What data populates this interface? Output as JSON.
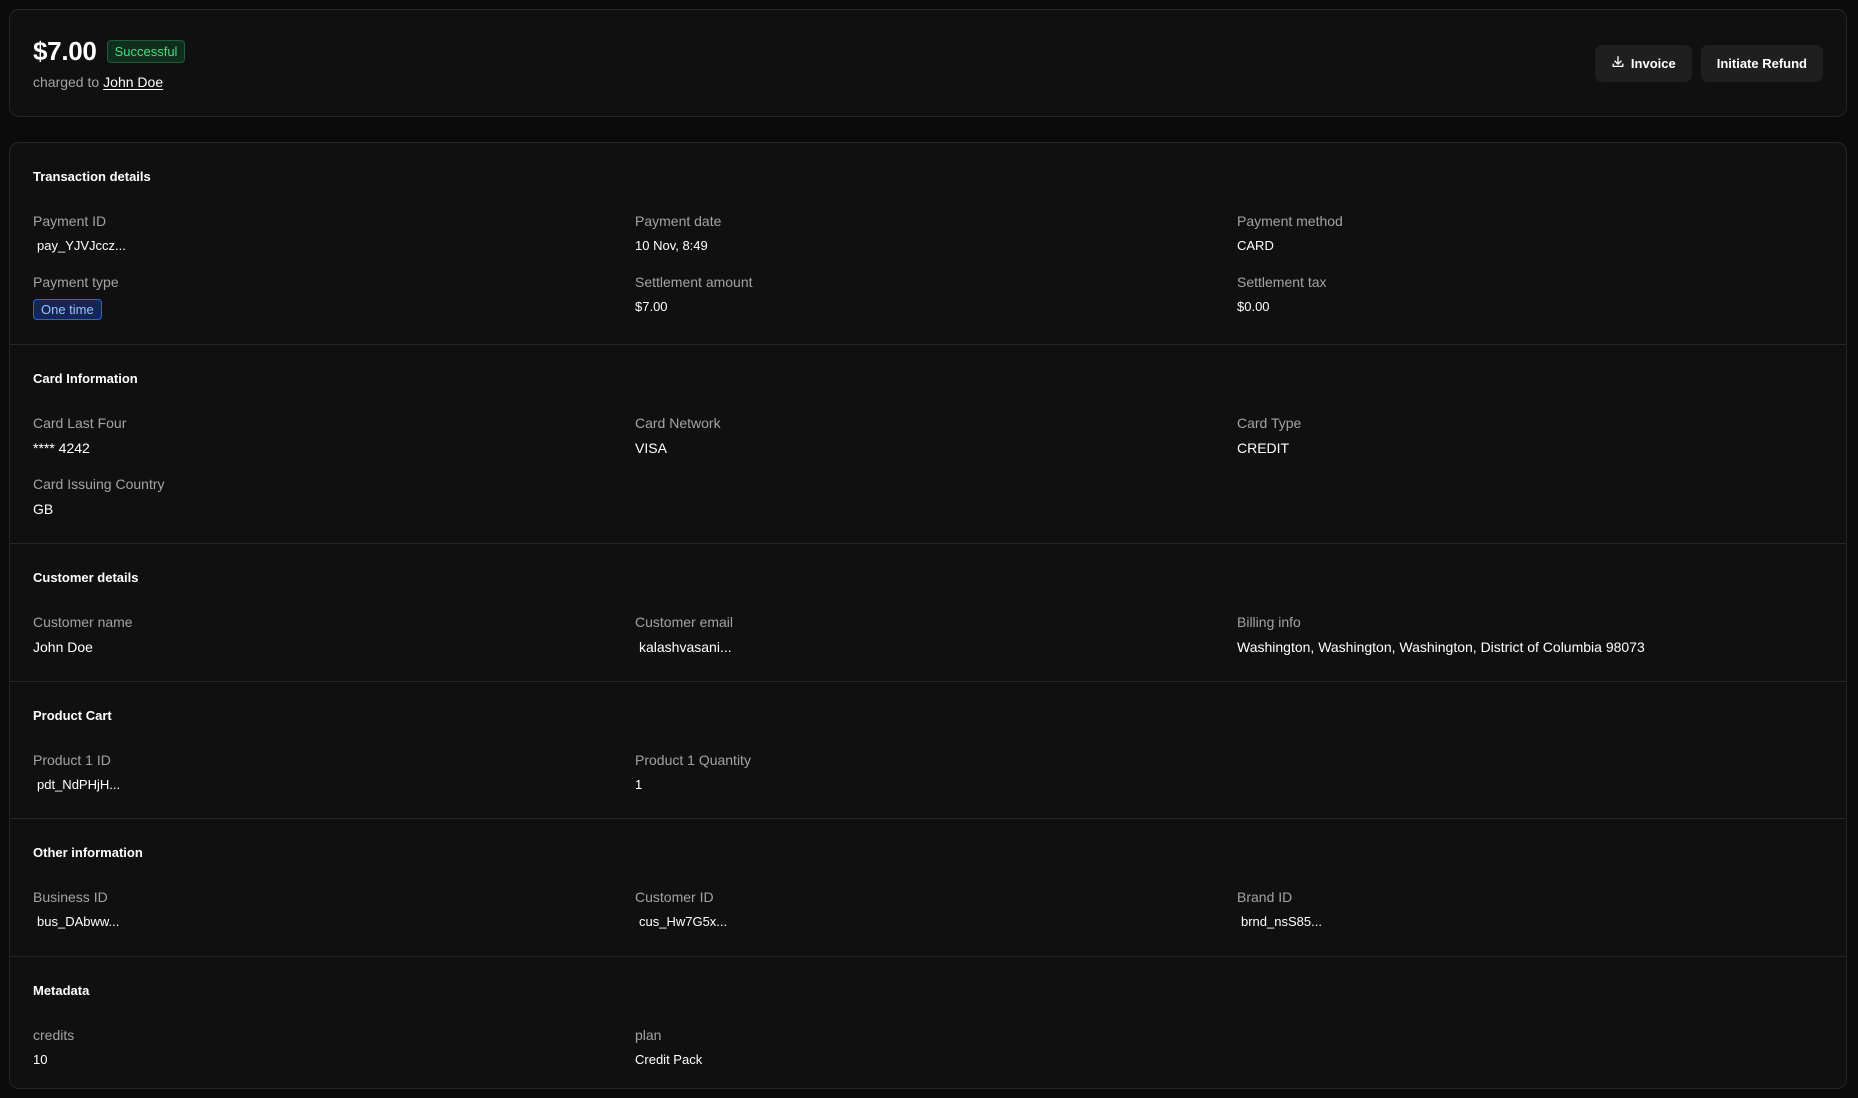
{
  "header": {
    "amount": "$7.00",
    "status": "Successful",
    "charged_to_label": "charged to",
    "customer_name": "John Doe",
    "invoice_label": "Invoice",
    "refund_label": "Initiate Refund"
  },
  "transaction": {
    "title": "Transaction details",
    "payment_id_label": "Payment ID",
    "payment_id": "pay_YJVJccz...",
    "payment_date_label": "Payment date",
    "payment_date": "10 Nov, 8:49",
    "payment_method_label": "Payment method",
    "payment_method": "CARD",
    "payment_type_label": "Payment type",
    "payment_type": "One time",
    "settlement_amount_label": "Settlement amount",
    "settlement_amount": "$7.00",
    "settlement_tax_label": "Settlement tax",
    "settlement_tax": "$0.00"
  },
  "card": {
    "title": "Card Information",
    "last_four_label": "Card Last Four",
    "last_four": "**** 4242",
    "network_label": "Card Network",
    "network": "VISA",
    "type_label": "Card Type",
    "type": "CREDIT",
    "country_label": "Card Issuing Country",
    "country": "GB"
  },
  "customer": {
    "title": "Customer details",
    "name_label": "Customer name",
    "name": "John Doe",
    "email_label": "Customer email",
    "email": "kalashvasani...",
    "billing_label": "Billing info",
    "billing": "Washington, Washington, Washington, District of Columbia 98073"
  },
  "cart": {
    "title": "Product Cart",
    "product_id_label": "Product 1 ID",
    "product_id": "pdt_NdPHjH...",
    "quantity_label": "Product 1 Quantity",
    "quantity": "1"
  },
  "other": {
    "title": "Other information",
    "business_id_label": "Business ID",
    "business_id": "bus_DAbww...",
    "customer_id_label": "Customer ID",
    "customer_id": "cus_Hw7G5x...",
    "brand_id_label": "Brand ID",
    "brand_id": "brnd_nsS85..."
  },
  "metadata": {
    "title": "Metadata",
    "credits_label": "credits",
    "credits": "10",
    "plan_label": "plan",
    "plan": "Credit Pack"
  },
  "icons": {
    "invoice": "download-icon"
  },
  "colors": {
    "background": "#0b0b0b",
    "card": "#101010",
    "success": "#4ade80",
    "pill": "#93c5fd"
  }
}
